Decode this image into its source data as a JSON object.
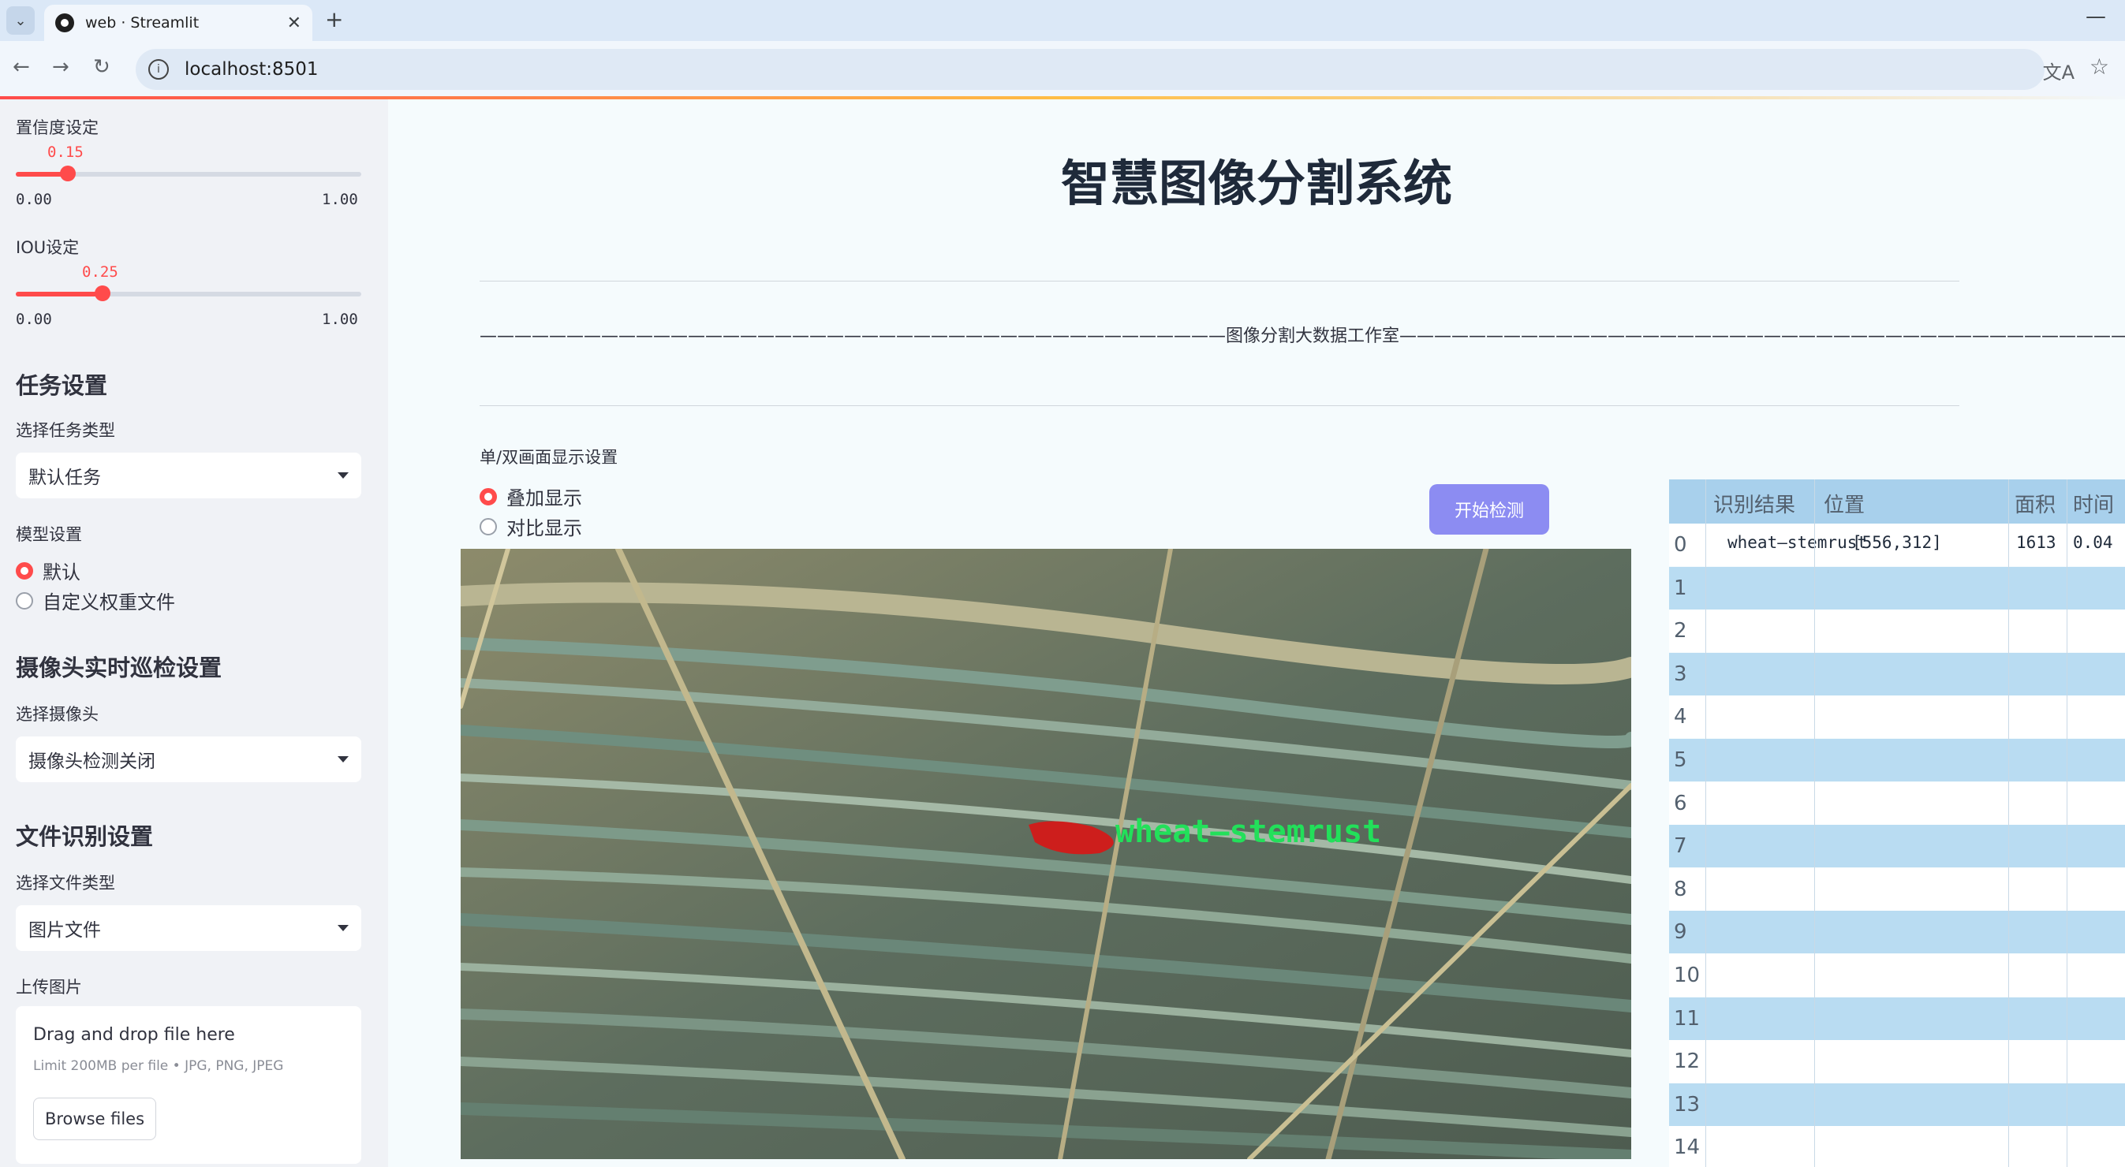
{
  "browser": {
    "tab_title": "web · Streamlit",
    "url": "localhost:8501"
  },
  "sidebar": {
    "confidence": {
      "label": "置信度设定",
      "value": "0.15",
      "value_num": 0.15,
      "min": "0.00",
      "max": "1.00"
    },
    "iou": {
      "label": "IOU设定",
      "value": "0.25",
      "value_num": 0.25,
      "min": "0.00",
      "max": "1.00"
    },
    "task_section": "任务设置",
    "task_type_label": "选择任务类型",
    "task_type_value": "默认任务",
    "model_label": "模型设置",
    "model_options": [
      "默认",
      "自定义权重文件"
    ],
    "model_selected": "默认",
    "camera_section": "摄像头实时巡检设置",
    "camera_label": "选择摄像头",
    "camera_value": "摄像头检测关闭",
    "file_section": "文件识别设置",
    "file_type_label": "选择文件类型",
    "file_type_value": "图片文件",
    "upload_label": "上传图片",
    "uploader": {
      "title": "Drag and drop file here",
      "limit": "Limit 200MB per file • JPG, PNG, JPEG",
      "button": "Browse files"
    }
  },
  "main": {
    "title": "智慧图像分割系统",
    "studio_line": "———————————————————————————————————————————图像分割大数据工作室———————————————————————————————————————————",
    "display_mode_label": "单/双画面显示设置",
    "display_options": [
      "叠加显示",
      "对比显示"
    ],
    "display_selected": "叠加显示",
    "start_button": "开始检测",
    "detection_label": "wheat—stemrust"
  },
  "results_table": {
    "columns": [
      "识别结果",
      "位置",
      "面积",
      "时间"
    ],
    "rows": [
      {
        "index": "0",
        "result": "wheat—stemrust",
        "position": "[556,312]",
        "area": "1613",
        "time": "0.04"
      },
      {
        "index": "1"
      },
      {
        "index": "2"
      },
      {
        "index": "3"
      },
      {
        "index": "4"
      },
      {
        "index": "5"
      },
      {
        "index": "6"
      },
      {
        "index": "7"
      },
      {
        "index": "8"
      },
      {
        "index": "9"
      },
      {
        "index": "10"
      },
      {
        "index": "11"
      },
      {
        "index": "12"
      },
      {
        "index": "13"
      },
      {
        "index": "14"
      }
    ]
  },
  "colors": {
    "accent": "#ff4b4b",
    "button": "#8c8cf2",
    "table_header": "#a8d0ec",
    "table_alt_row": "#b9dcf2",
    "detection_text": "#22e05a",
    "detection_mask": "#e01010"
  }
}
